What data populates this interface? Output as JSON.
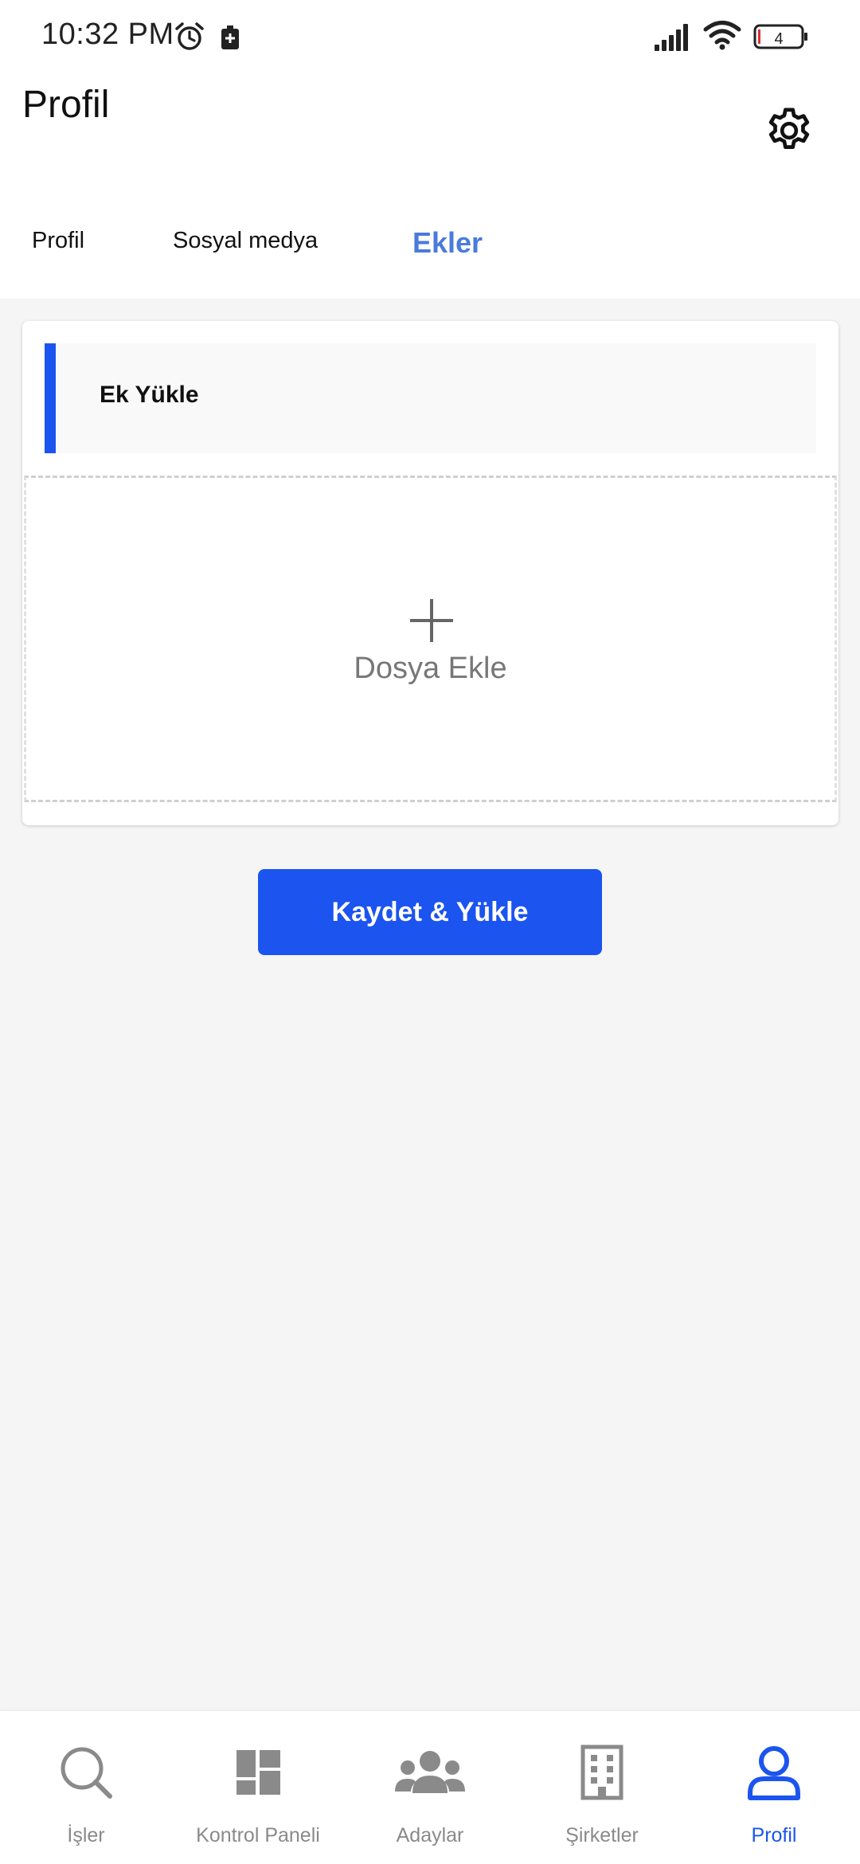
{
  "status_bar": {
    "time": "10:32 PM",
    "battery_level": "4",
    "icons": [
      "alarm-icon",
      "battery-saver-icon",
      "signal-icon",
      "wifi-icon",
      "battery-icon"
    ]
  },
  "header": {
    "title": "Profil",
    "settings_icon": "gear-icon"
  },
  "tabs": [
    {
      "label": "Profil",
      "active": false
    },
    {
      "label": "Sosyal medya",
      "active": false
    },
    {
      "label": "Ekler",
      "active": true
    }
  ],
  "upload_card": {
    "title": "Ek Yükle",
    "dropzone_label": "Dosya Ekle",
    "dropzone_icon": "plus-icon"
  },
  "save_button": {
    "label": "Kaydet & Yükle"
  },
  "bottom_nav": {
    "items": [
      {
        "label": "İşler",
        "icon": "search-icon",
        "active": false
      },
      {
        "label": "Kontrol Paneli",
        "icon": "dashboard-icon",
        "active": false
      },
      {
        "label": "Adaylar",
        "icon": "people-icon",
        "active": false
      },
      {
        "label": "Şirketler",
        "icon": "building-icon",
        "active": false
      },
      {
        "label": "Profil",
        "icon": "person-icon",
        "active": true
      }
    ]
  },
  "colors": {
    "accent": "#1c54ef",
    "active_tab": "#4a7bdc",
    "inactive_nav": "#8a8a8a",
    "background": "#f5f5f6"
  }
}
